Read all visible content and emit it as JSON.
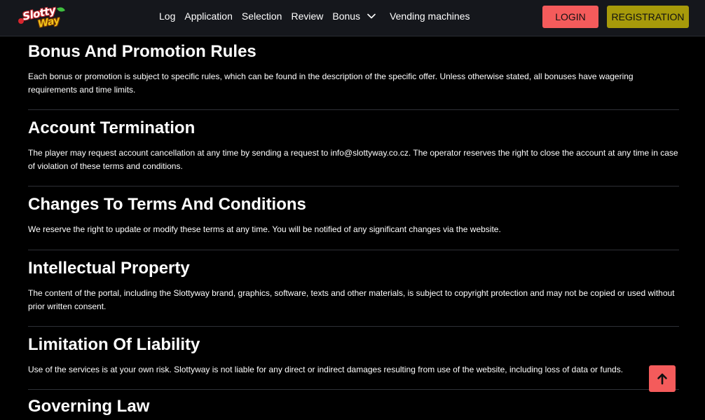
{
  "header": {
    "logo_line1": "Slotty",
    "logo_line2": "Way",
    "nav": [
      {
        "label": "Log"
      },
      {
        "label": "Application"
      },
      {
        "label": "Selection"
      },
      {
        "label": "Review"
      },
      {
        "label": "Bonus"
      },
      {
        "label": "Vending machines"
      }
    ],
    "login_label": "LOGIN",
    "register_label": "REGISTRATION"
  },
  "sections": [
    {
      "title": "Bonus And Promotion Rules",
      "text": "Each bonus or promotion is subject to specific rules, which can be found in the description of the specific offer. Unless otherwise stated, all bonuses have wagering requirements and time limits."
    },
    {
      "title": "Account Termination",
      "text": "The player may request account cancellation at any time by sending a request to info@slottyway.co.cz. The operator reserves the right to close the account at any time in case of violation of these terms and conditions."
    },
    {
      "title": "Changes To Terms And Conditions",
      "text": "We reserve the right to update or modify these terms at any time. You will be notified of any significant changes via the website."
    },
    {
      "title": "Intellectual Property",
      "text": "The content of the portal, including the Slottyway brand, graphics, software, texts and other materials, is subject to copyright protection and may not be copied or used without prior written consent."
    },
    {
      "title": "Limitation Of Liability",
      "text": "Use of the services is at your own risk. Slottyway is not liable for any direct or indirect damages resulting from use of the website, including loss of data or funds."
    },
    {
      "title": "Governing Law",
      "text": ""
    }
  ],
  "colors": {
    "accent_red": "#f45b5b",
    "accent_olive": "#a79a0a",
    "header_bg": "#15171c",
    "page_bg": "#000000"
  },
  "icons": {
    "bonus_dropdown": "chevron-down-icon",
    "scroll_top": "arrow-up-icon"
  }
}
